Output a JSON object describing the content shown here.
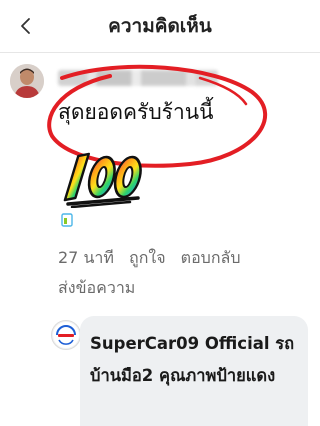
{
  "header": {
    "title": "ความคิดเห็น",
    "back_icon": "chevron-left-icon"
  },
  "comment": {
    "text": "สุดยอดครับร้านนี้",
    "sticker_text": "100",
    "highlight_color": "#e31e24"
  },
  "comment_meta": {
    "time": "27 นาที",
    "like": "ถูกใจ",
    "reply": "ตอบกลับ",
    "send_message": "ส่งข้อความ"
  },
  "reply": {
    "page_name": "SuperCar09 Official",
    "text": "SuperCar09 Official รถบ้านมือ2 คุณภาพป้ายแดง"
  }
}
